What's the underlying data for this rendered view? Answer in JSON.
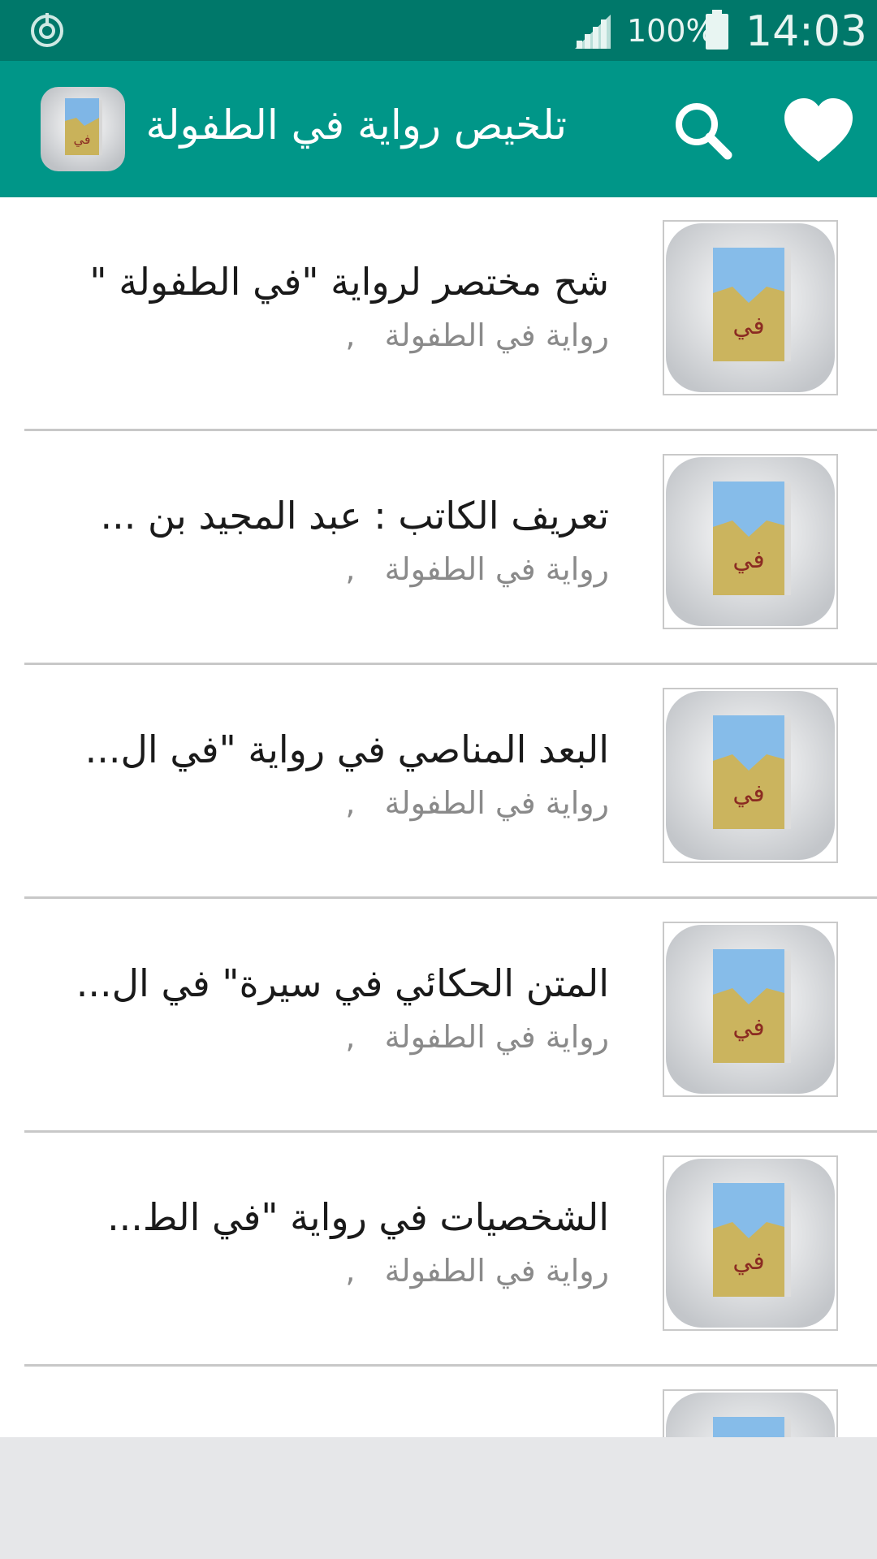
{
  "status_bar": {
    "battery_percent": "100%",
    "time": "14:03",
    "icons": [
      "sync-icon",
      "signal-icon",
      "battery-icon"
    ]
  },
  "app_bar": {
    "title": "تلخيص رواية في الطفولة",
    "icons": [
      "book-cover-icon",
      "search-icon",
      "heart-icon"
    ]
  },
  "list": {
    "items": [
      {
        "title": "شح مختصر لرواية \"في الطفولة \"",
        "subtitle": "رواية في الطفولة   ,"
      },
      {
        "title": "تعريف الكاتب : عبد المجيد بن ...",
        "subtitle": "رواية في الطفولة   ,"
      },
      {
        "title": "البعد المناصي في رواية \"في ال...",
        "subtitle": "رواية في الطفولة   ,"
      },
      {
        "title": "المتن الحكائي في سيرة\" في ال...",
        "subtitle": "رواية في الطفولة   ,"
      },
      {
        "title": "الشخصيات  في رواية \"في الط...",
        "subtitle": "رواية في الطفولة   ,"
      },
      {
        "title": "",
        "subtitle": ""
      }
    ]
  },
  "colors": {
    "status_bar": "#00786a",
    "app_bar": "#009688",
    "divider": "#c8c8c8",
    "bottom_area": "#e6e7e9"
  }
}
